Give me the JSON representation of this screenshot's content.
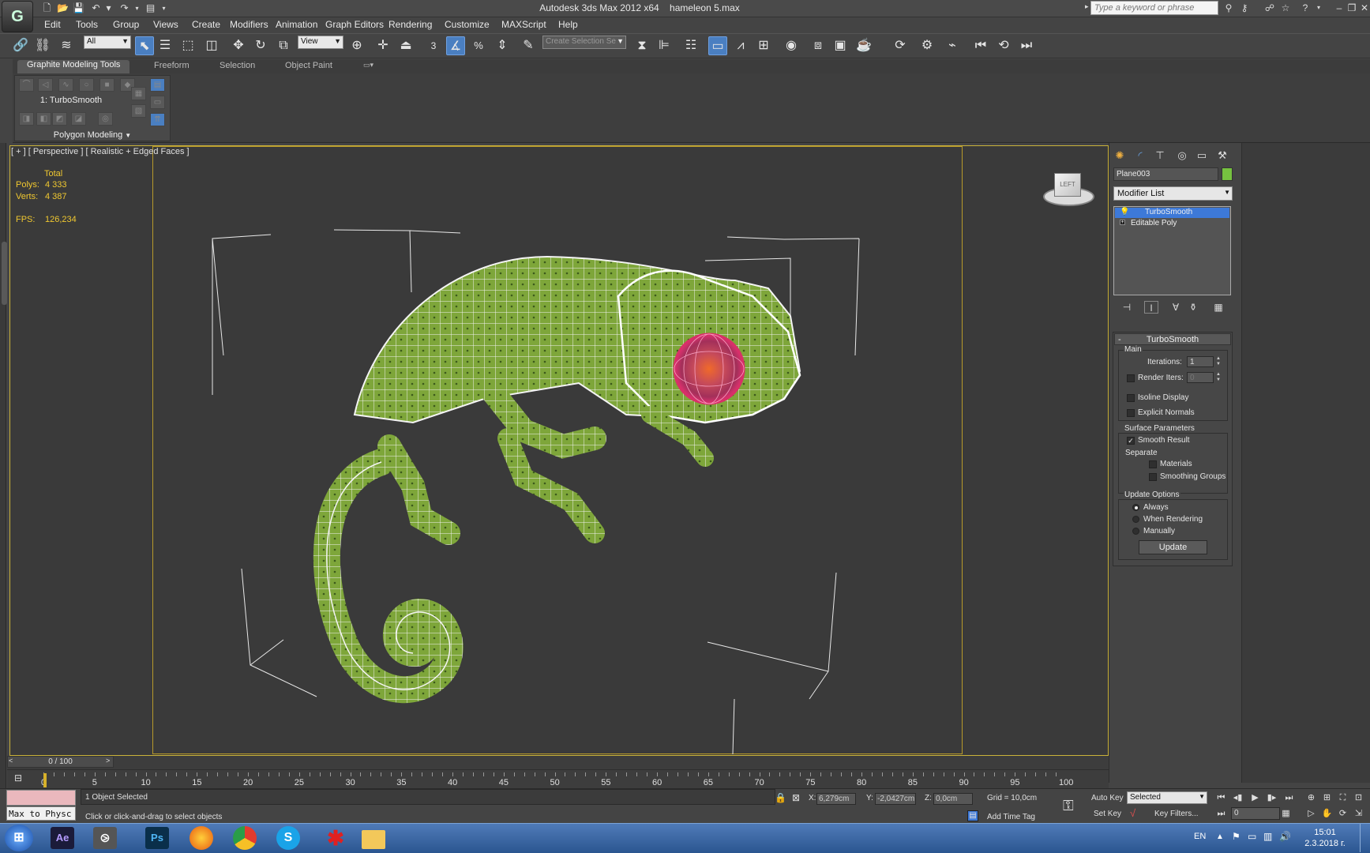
{
  "title_bar": {
    "app_logo_text": "G",
    "app_name": "Autodesk 3ds Max  2012 x64",
    "file_name": "hameleon 5.max",
    "search_placeholder": "Type a keyword or phrase",
    "help_label": "?"
  },
  "menu": [
    "Edit",
    "Tools",
    "Group",
    "Views",
    "Create",
    "Modifiers",
    "Animation",
    "Graph Editors",
    "Rendering",
    "Customize",
    "MAXScript",
    "Help"
  ],
  "main_toolbar": {
    "selection_filter": "All",
    "reference_coord": "View",
    "named_selection": "Create Selection Se",
    "snap_label": "3",
    "percent_label": "%"
  },
  "ribbon": {
    "tabs": [
      "Graphite Modeling Tools",
      "Freeform",
      "Selection",
      "Object Paint"
    ],
    "active_tab": 0,
    "stack_label": "1: TurboSmooth",
    "panel_title": "Polygon Modeling"
  },
  "viewport": {
    "label": "[ + ] [ Perspective ] [ Realistic + Edged Faces ]",
    "stats": {
      "header": "Total",
      "polys_label": "Polys:",
      "polys_value": "4 333",
      "verts_label": "Verts:",
      "verts_value": "4 387",
      "fps_label": "FPS:",
      "fps_value": "126,234"
    },
    "viewcube_face": "LEFT"
  },
  "command_panel": {
    "object_name": "Plane003",
    "object_color": "#76c240",
    "modifier_list": "Modifier List",
    "stack": [
      "TurboSmooth",
      "Editable Poly"
    ],
    "selected_stack_index": 0
  },
  "turbosmooth": {
    "title": "TurboSmooth",
    "main_group": "Main",
    "iterations_label": "Iterations:",
    "iterations_value": "1",
    "render_iters_label": "Render Iters:",
    "render_iters_value": "0",
    "isoline_label": "Isoline Display",
    "explicit_normals_label": "Explicit Normals",
    "surface_group": "Surface Parameters",
    "smooth_result_label": "Smooth Result",
    "separate_label": "Separate",
    "materials_label": "Materials",
    "smoothing_groups_label": "Smoothing Groups",
    "update_group": "Update Options",
    "always_label": "Always",
    "when_rendering_label": "When Rendering",
    "manually_label": "Manually",
    "update_button": "Update"
  },
  "timeline": {
    "slider_label": "0 / 100",
    "ticks": [
      "0",
      "5",
      "10",
      "15",
      "20",
      "25",
      "30",
      "35",
      "40",
      "45",
      "50",
      "55",
      "60",
      "65",
      "70",
      "75",
      "80",
      "85",
      "90",
      "95",
      "100"
    ]
  },
  "status": {
    "listener_text": "Max to Physc",
    "selection_status": "1 Object Selected",
    "prompt": "Click or click-and-drag to select objects",
    "x_label": "X:",
    "x_value": "6,279cm",
    "y_label": "Y:",
    "y_value": "-2,0427cm",
    "z_label": "Z:",
    "z_value": "0,0cm",
    "grid": "Grid = 10,0cm",
    "add_time_tag": "Add Time Tag",
    "auto_key": "Auto Key",
    "set_key": "Set Key",
    "key_mode": "Selected",
    "key_filters": "Key Filters...",
    "frame": "0"
  },
  "taskbar": {
    "apps": [
      "windows-start",
      "after-effects",
      "3ds-max",
      "photoshop",
      "firefox",
      "chrome",
      "skype",
      "app-red",
      "file-explorer"
    ],
    "ae_label": "Ae",
    "ps_label": "Ps",
    "lang": "EN",
    "time": "15:01",
    "date": "2.3.2018 г."
  }
}
